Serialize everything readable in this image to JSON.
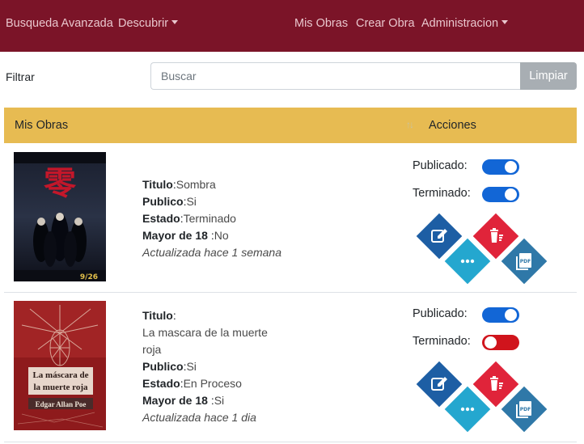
{
  "navbar": {
    "advanced_search": "Busqueda Avanzada",
    "discover": "Descubrir",
    "my_works": "Mis Obras",
    "create_work": "Crear Obra",
    "administration": "Administracion"
  },
  "filter": {
    "label": "Filtrar",
    "placeholder": "Buscar",
    "clear_label": "Limpiar"
  },
  "table": {
    "col_title": "Mis Obras",
    "sort_icon": "↑↓",
    "col_actions": "Acciones"
  },
  "labels": {
    "title": "Titulo",
    "public": "Publico",
    "status": "Estado",
    "adult": "Mayor de 18",
    "published": "Publicado:",
    "finished": "Terminado:"
  },
  "rows": [
    {
      "title": "Sombra",
      "public": "Si",
      "status": "Terminado",
      "adult": "No",
      "updated": "Actualizada hace 1 semana",
      "published": true,
      "finished": true,
      "cover_text": [
        "零",
        "9/26"
      ]
    },
    {
      "title_line1": "La mascara de la muerte",
      "title_line2": "roja",
      "public": "Si",
      "status": "En Proceso",
      "adult": "Si",
      "updated": "Actualizada hace 1 dia",
      "published": true,
      "finished": false,
      "cover_text": [
        "La máscara de",
        "la muerte roja",
        "Edgar Allan Poe"
      ]
    }
  ],
  "icons": {
    "edit": "edit-icon",
    "delete": "trash-icon",
    "more": "more-icon",
    "pdf": "pdf-icon"
  },
  "colors": {
    "navbar": "#7b1428",
    "table_header": "#e7bb52",
    "switch_on": "#1266d6",
    "switch_off": "#d0141c",
    "edit": "#1d5ea4",
    "delete": "#e0243a",
    "more": "#24a7cf",
    "pdf": "#2f78a8"
  }
}
